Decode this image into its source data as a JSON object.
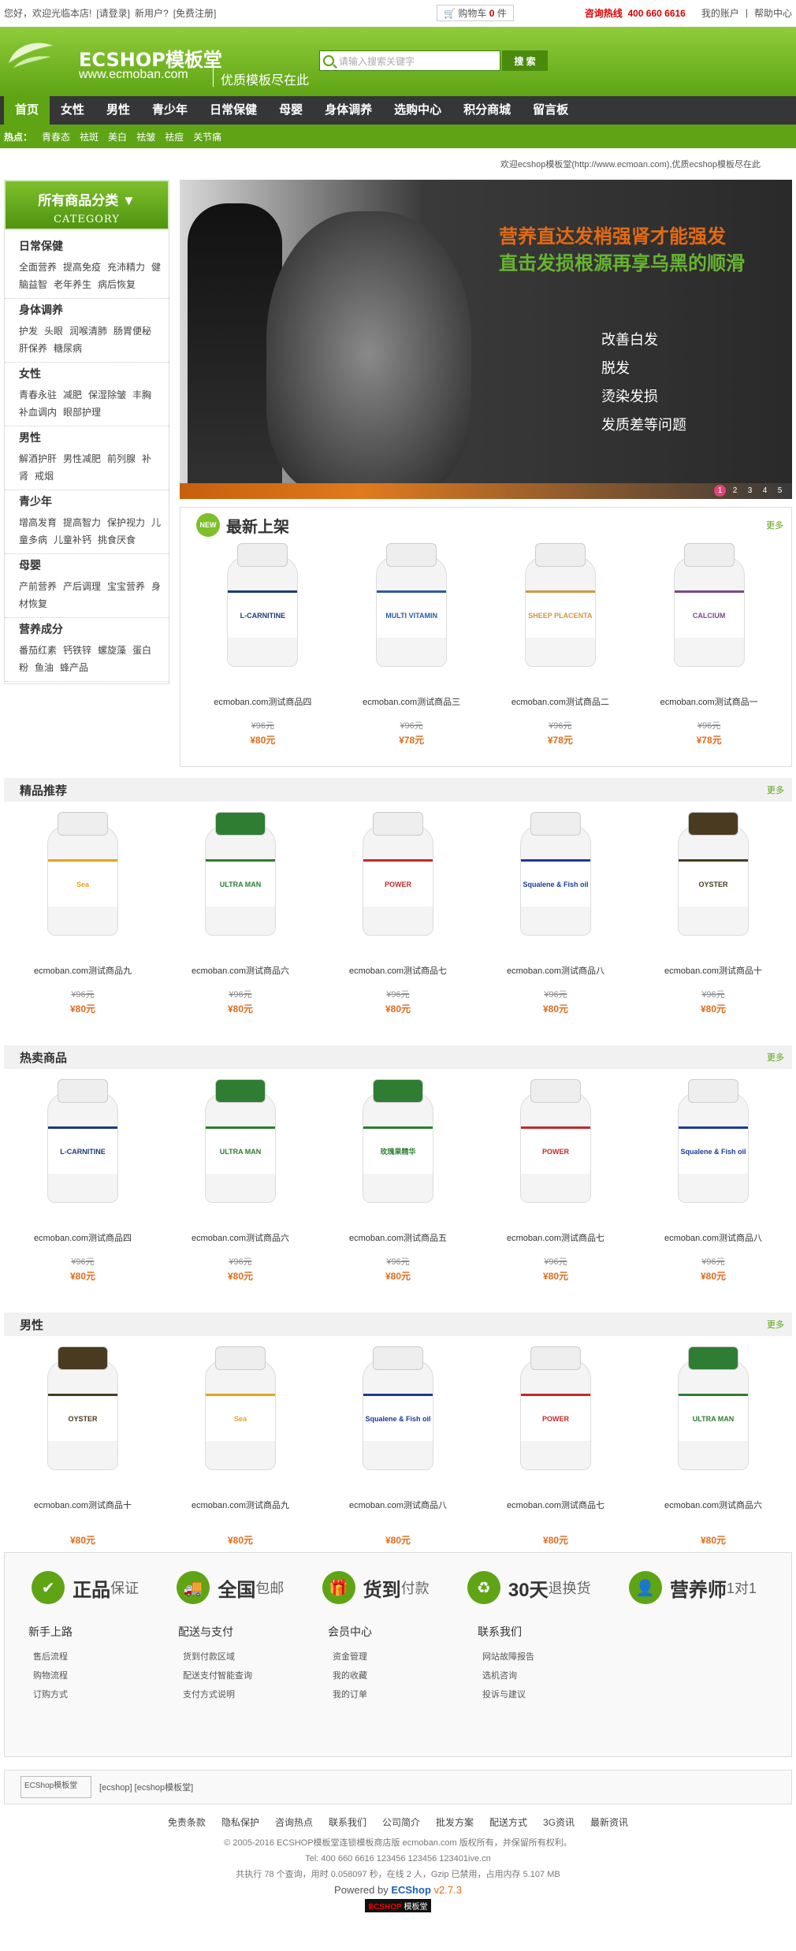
{
  "topbar": {
    "greeting": "您好，欢迎光临本店!",
    "login": "[请登录]",
    "newuser": "新用户?",
    "register": "[免费注册]",
    "cart_label": "购物车",
    "cart_count": "0",
    "cart_unit": "件",
    "hotline_label": "咨询热线",
    "hotline_number": "400 660 6616",
    "my_account": "我的账户",
    "help_center": "帮助中心"
  },
  "header": {
    "logo_title": "ECSHOP模板堂",
    "logo_url": "www.ecmoban.com",
    "slogan": "优质模板尽在此",
    "search_placeholder": "请输入搜索关键字",
    "search_button": "搜 索"
  },
  "nav": [
    "首页",
    "女性",
    "男性",
    "青少年",
    "日常保健",
    "母婴",
    "身体调养",
    "选购中心",
    "积分商城",
    "留言板"
  ],
  "hot": {
    "label": "热点：",
    "items": [
      "青春态",
      "祛斑",
      "美白",
      "祛皱",
      "祛痘",
      "关节痛"
    ]
  },
  "welcome_text": "欢迎ecshop模板堂(http://www.ecmoan.com),优质ecshop模板尽在此",
  "sidebar": {
    "title": "所有商品分类 ▼",
    "subtitle": "CATEGORY",
    "groups": [
      {
        "name": "日常保健",
        "items": [
          "全面营养",
          "提高免疫",
          "充沛精力",
          "健脑益智",
          "老年养生",
          "病后恢复"
        ]
      },
      {
        "name": "身体调养",
        "items": [
          "护发",
          "头眼",
          "润喉清肺",
          "肠胃便秘",
          "肝保养",
          "糖尿病"
        ]
      },
      {
        "name": "女性",
        "items": [
          "青春永驻",
          "减肥",
          "保湿除皱",
          "丰胸",
          "补血调内",
          "眼部护理"
        ]
      },
      {
        "name": "男性",
        "items": [
          "解酒护肝",
          "男性减肥",
          "前列腺",
          "补肾",
          "戒烟"
        ]
      },
      {
        "name": "青少年",
        "items": [
          "增高发育",
          "提高智力",
          "保护视力",
          "儿童多病",
          "儿童补钙",
          "挑食厌食"
        ]
      },
      {
        "name": "母婴",
        "items": [
          "产前营养",
          "产后调理",
          "宝宝营养",
          "身材恢复"
        ]
      },
      {
        "name": "营养成分",
        "items": [
          "番茄红素",
          "钙铁锌",
          "螺旋藻",
          "蛋白粉",
          "鱼油",
          "蜂产品"
        ]
      }
    ]
  },
  "banner": {
    "headline1": "营养直达发梢强肾才能强发",
    "headline2": "直击发损根源再享乌黑的顺滑",
    "bullets": [
      "改善白发",
      "脱发",
      "烫染发损",
      "发质差等问题"
    ],
    "dots": [
      "1",
      "2",
      "3",
      "4",
      "5"
    ]
  },
  "newest": {
    "badge": "NEW",
    "title": "最新上架",
    "more": "更多",
    "products": [
      {
        "name": "ecmoban.com测试商品四",
        "old": "¥96元",
        "price": "¥80元",
        "label": "L-CARNITINE"
      },
      {
        "name": "ecmoban.com测试商品三",
        "old": "¥96元",
        "price": "¥78元",
        "label": "MULTI VITAMIN"
      },
      {
        "name": "ecmoban.com测试商品二",
        "old": "¥96元",
        "price": "¥78元",
        "label": "SHEEP PLACENTA"
      },
      {
        "name": "ecmoban.com测试商品一",
        "old": "¥96元",
        "price": "¥78元",
        "label": "CALCIUM"
      }
    ]
  },
  "best": {
    "title": "精品推荐",
    "more": "更多",
    "products": [
      {
        "name": "ecmoban.com测试商品九",
        "old": "¥96元",
        "price": "¥80元",
        "label": "Sea"
      },
      {
        "name": "ecmoban.com测试商品六",
        "old": "¥96元",
        "price": "¥80元",
        "label": "ULTRA MAN"
      },
      {
        "name": "ecmoban.com测试商品七",
        "old": "¥96元",
        "price": "¥80元",
        "label": "POWER"
      },
      {
        "name": "ecmoban.com测试商品八",
        "old": "¥96元",
        "price": "¥80元",
        "label": "Squalene & Fish oil"
      },
      {
        "name": "ecmoban.com测试商品十",
        "old": "¥96元",
        "price": "¥80元",
        "label": "OYSTER"
      }
    ]
  },
  "hotsale": {
    "title": "热卖商品",
    "more": "更多",
    "products": [
      {
        "name": "ecmoban.com测试商品四",
        "old": "¥96元",
        "price": "¥80元",
        "label": "L-CARNITINE"
      },
      {
        "name": "ecmoban.com测试商品六",
        "old": "¥96元",
        "price": "¥80元",
        "label": "ULTRA MAN"
      },
      {
        "name": "ecmoban.com测试商品五",
        "old": "¥96元",
        "price": "¥80元",
        "label": "玫瑰果精华"
      },
      {
        "name": "ecmoban.com测试商品七",
        "old": "¥96元",
        "price": "¥80元",
        "label": "POWER"
      },
      {
        "name": "ecmoban.com测试商品八",
        "old": "¥96元",
        "price": "¥80元",
        "label": "Squalene & Fish oil"
      }
    ]
  },
  "male": {
    "title": "男性",
    "more": "更多",
    "products": [
      {
        "name": "ecmoban.com测试商品十",
        "price": "¥80元",
        "label": "OYSTER"
      },
      {
        "name": "ecmoban.com测试商品九",
        "price": "¥80元",
        "label": "Sea"
      },
      {
        "name": "ecmoban.com测试商品八",
        "price": "¥80元",
        "label": "Squalene & Fish oil"
      },
      {
        "name": "ecmoban.com测试商品七",
        "price": "¥80元",
        "label": "POWER"
      },
      {
        "name": "ecmoban.com测试商品六",
        "price": "¥80元",
        "label": "ULTRA MAN"
      }
    ]
  },
  "promises": [
    {
      "big": "正品",
      "small": "保证"
    },
    {
      "big": "全国",
      "small": "包邮"
    },
    {
      "big": "货到",
      "small": "付款"
    },
    {
      "big": "30天",
      "small": "退换货"
    },
    {
      "big": "营养师",
      "small": "1对1"
    }
  ],
  "help": [
    {
      "title": "新手上路",
      "items": [
        "售后流程",
        "购物流程",
        "订购方式"
      ]
    },
    {
      "title": "配送与支付",
      "items": [
        "货到付款区域",
        "配送支付智能查询",
        "支付方式说明"
      ]
    },
    {
      "title": "会员中心",
      "items": [
        "资金管理",
        "我的收藏",
        "我的订单"
      ]
    },
    {
      "title": "联系我们",
      "items": [
        "网站故障报告",
        "选机咨询",
        "投诉与建议"
      ]
    }
  ],
  "friend_links": {
    "img_alt": "ECShop模板堂",
    "text": "[ecshop] [ecshop模板堂]"
  },
  "footer_nav": [
    "免责条款",
    "隐私保护",
    "咨询热点",
    "联系我们",
    "公司简介",
    "批发方案",
    "配送方式",
    "3G资讯",
    "最新资讯"
  ],
  "copyright": "© 2005-2016 ECSHOP模板堂连锁模板商店版 ecmoban.com 版权所有，并保留所有权利。",
  "contact": "Tel: 400 660 6616  123456  123456  123401ive.cn",
  "stats": "共执行 78 个查询，用时 0.058097 秒，在线 2 人，Gzip 已禁用，占用内存 5.107 MB",
  "powered": {
    "prefix": "Powered by",
    "brand": "ECShop",
    "version": "v2.7.3"
  },
  "badge": {
    "a": "ECSHOP",
    "b": "模板堂"
  }
}
